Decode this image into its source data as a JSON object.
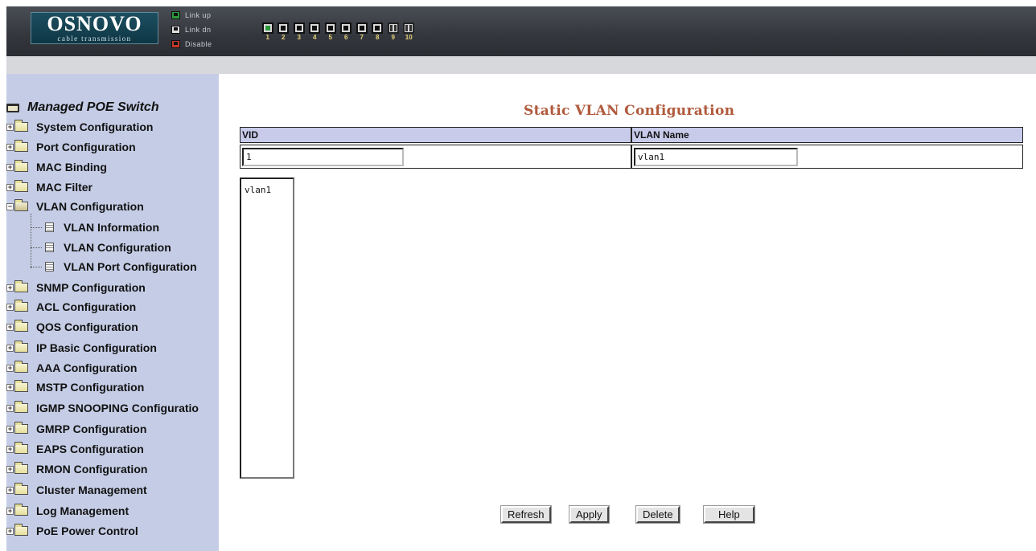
{
  "header": {
    "logo_main": "OSNOVO",
    "logo_sub": "cable transmission",
    "legend": [
      {
        "label": "Link up",
        "color": "#2c9a3c"
      },
      {
        "label": "Link dn",
        "color": "#111111"
      },
      {
        "label": "Disable",
        "color": "#c0392b"
      }
    ],
    "ports": [
      {
        "num": "1",
        "state": "up",
        "type": "copper"
      },
      {
        "num": "2",
        "state": "down",
        "type": "copper"
      },
      {
        "num": "3",
        "state": "down",
        "type": "copper"
      },
      {
        "num": "4",
        "state": "down",
        "type": "copper"
      },
      {
        "num": "5",
        "state": "down",
        "type": "copper"
      },
      {
        "num": "6",
        "state": "down",
        "type": "copper"
      },
      {
        "num": "7",
        "state": "down",
        "type": "copper"
      },
      {
        "num": "8",
        "state": "down",
        "type": "copper"
      },
      {
        "num": "9",
        "state": "down",
        "type": "fiber"
      },
      {
        "num": "10",
        "state": "down",
        "type": "fiber"
      }
    ]
  },
  "sidebar": {
    "root_label": "Managed POE Switch",
    "items": [
      {
        "label": "System Configuration"
      },
      {
        "label": "Port Configuration"
      },
      {
        "label": "MAC Binding"
      },
      {
        "label": "MAC Filter"
      },
      {
        "label": "VLAN Configuration",
        "expanded": true
      },
      {
        "label": "SNMP Configuration"
      },
      {
        "label": "ACL Configuration"
      },
      {
        "label": "QOS Configuration"
      },
      {
        "label": "IP Basic Configuration"
      },
      {
        "label": "AAA Configuration"
      },
      {
        "label": "MSTP Configuration"
      },
      {
        "label": "IGMP SNOOPING Configuratio"
      },
      {
        "label": "GMRP Configuration"
      },
      {
        "label": "EAPS Configuration"
      },
      {
        "label": "RMON Configuration"
      },
      {
        "label": "Cluster Management"
      },
      {
        "label": "Log Management"
      },
      {
        "label": "PoE Power Control"
      }
    ],
    "vlan_subitems": [
      {
        "label": "VLAN Information"
      },
      {
        "label": "VLAN Configuration"
      },
      {
        "label": "VLAN Port Configuration"
      }
    ]
  },
  "main": {
    "title": "Static VLAN Configuration",
    "table": {
      "col_vid": "VID",
      "col_vlan_name": "VLAN Name",
      "vid_value": "1",
      "vlan_name_value": "vlan1"
    },
    "vlan_list": [
      "vlan1"
    ],
    "buttons": {
      "refresh": "Refresh",
      "apply": "Apply",
      "delete": "Delete",
      "help": "Help"
    }
  },
  "colors": {
    "header_bg": "#33363c",
    "sidebar_bg": "#c5cde6",
    "title_color": "#b05a3c",
    "table_header_bg": "#c8cbea"
  }
}
